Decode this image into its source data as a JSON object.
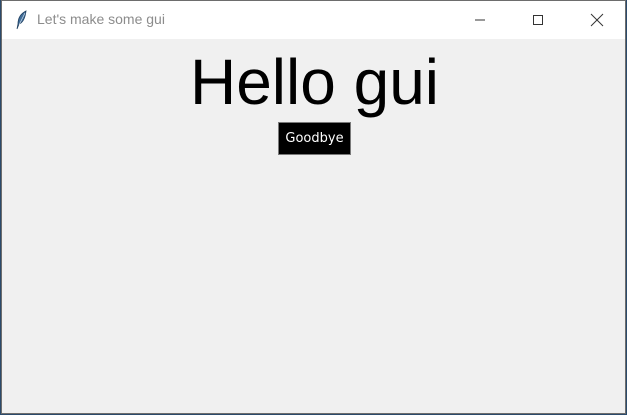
{
  "window": {
    "title": "Let's make some gui",
    "app_icon": "feather-icon",
    "controls": {
      "minimize_icon": "minimize-icon",
      "maximize_icon": "maximize-icon",
      "close_icon": "close-icon"
    }
  },
  "main": {
    "heading": "Hello gui",
    "button_label": "Goodbye"
  },
  "colors": {
    "client_background": "#f0f0f0",
    "titlebar_background": "#ffffff",
    "title_text": "#8c8c8c",
    "button_background": "#000000",
    "button_text": "#ffffff"
  }
}
